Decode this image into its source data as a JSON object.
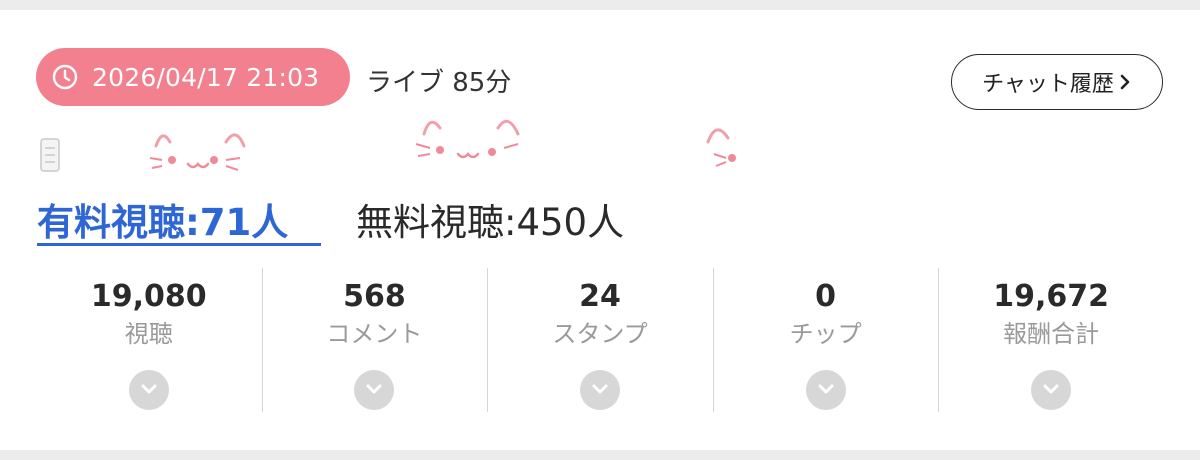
{
  "header": {
    "icon": "clock-icon",
    "datetime": "2026/04/17 21:03",
    "live_duration": "ライブ 85分",
    "chat_history_label": "チャット履歴",
    "chat_history_icon": "chevron-right-icon"
  },
  "colors": {
    "accent_pink": "#f3808f",
    "paid_blue": "#2f66d6",
    "text_dark": "#2a2a2a",
    "text_gray": "#9a9a9a"
  },
  "viewers": {
    "paid": "有料視聴:71人",
    "free": "無料視聴:450人"
  },
  "stats": [
    {
      "value": "19,080",
      "label": "視聴"
    },
    {
      "value": "568",
      "label": "コメント"
    },
    {
      "value": "24",
      "label": "スタンプ"
    },
    {
      "value": "0",
      "label": "チップ"
    },
    {
      "value": "19,672",
      "label": "報酬合計"
    }
  ]
}
